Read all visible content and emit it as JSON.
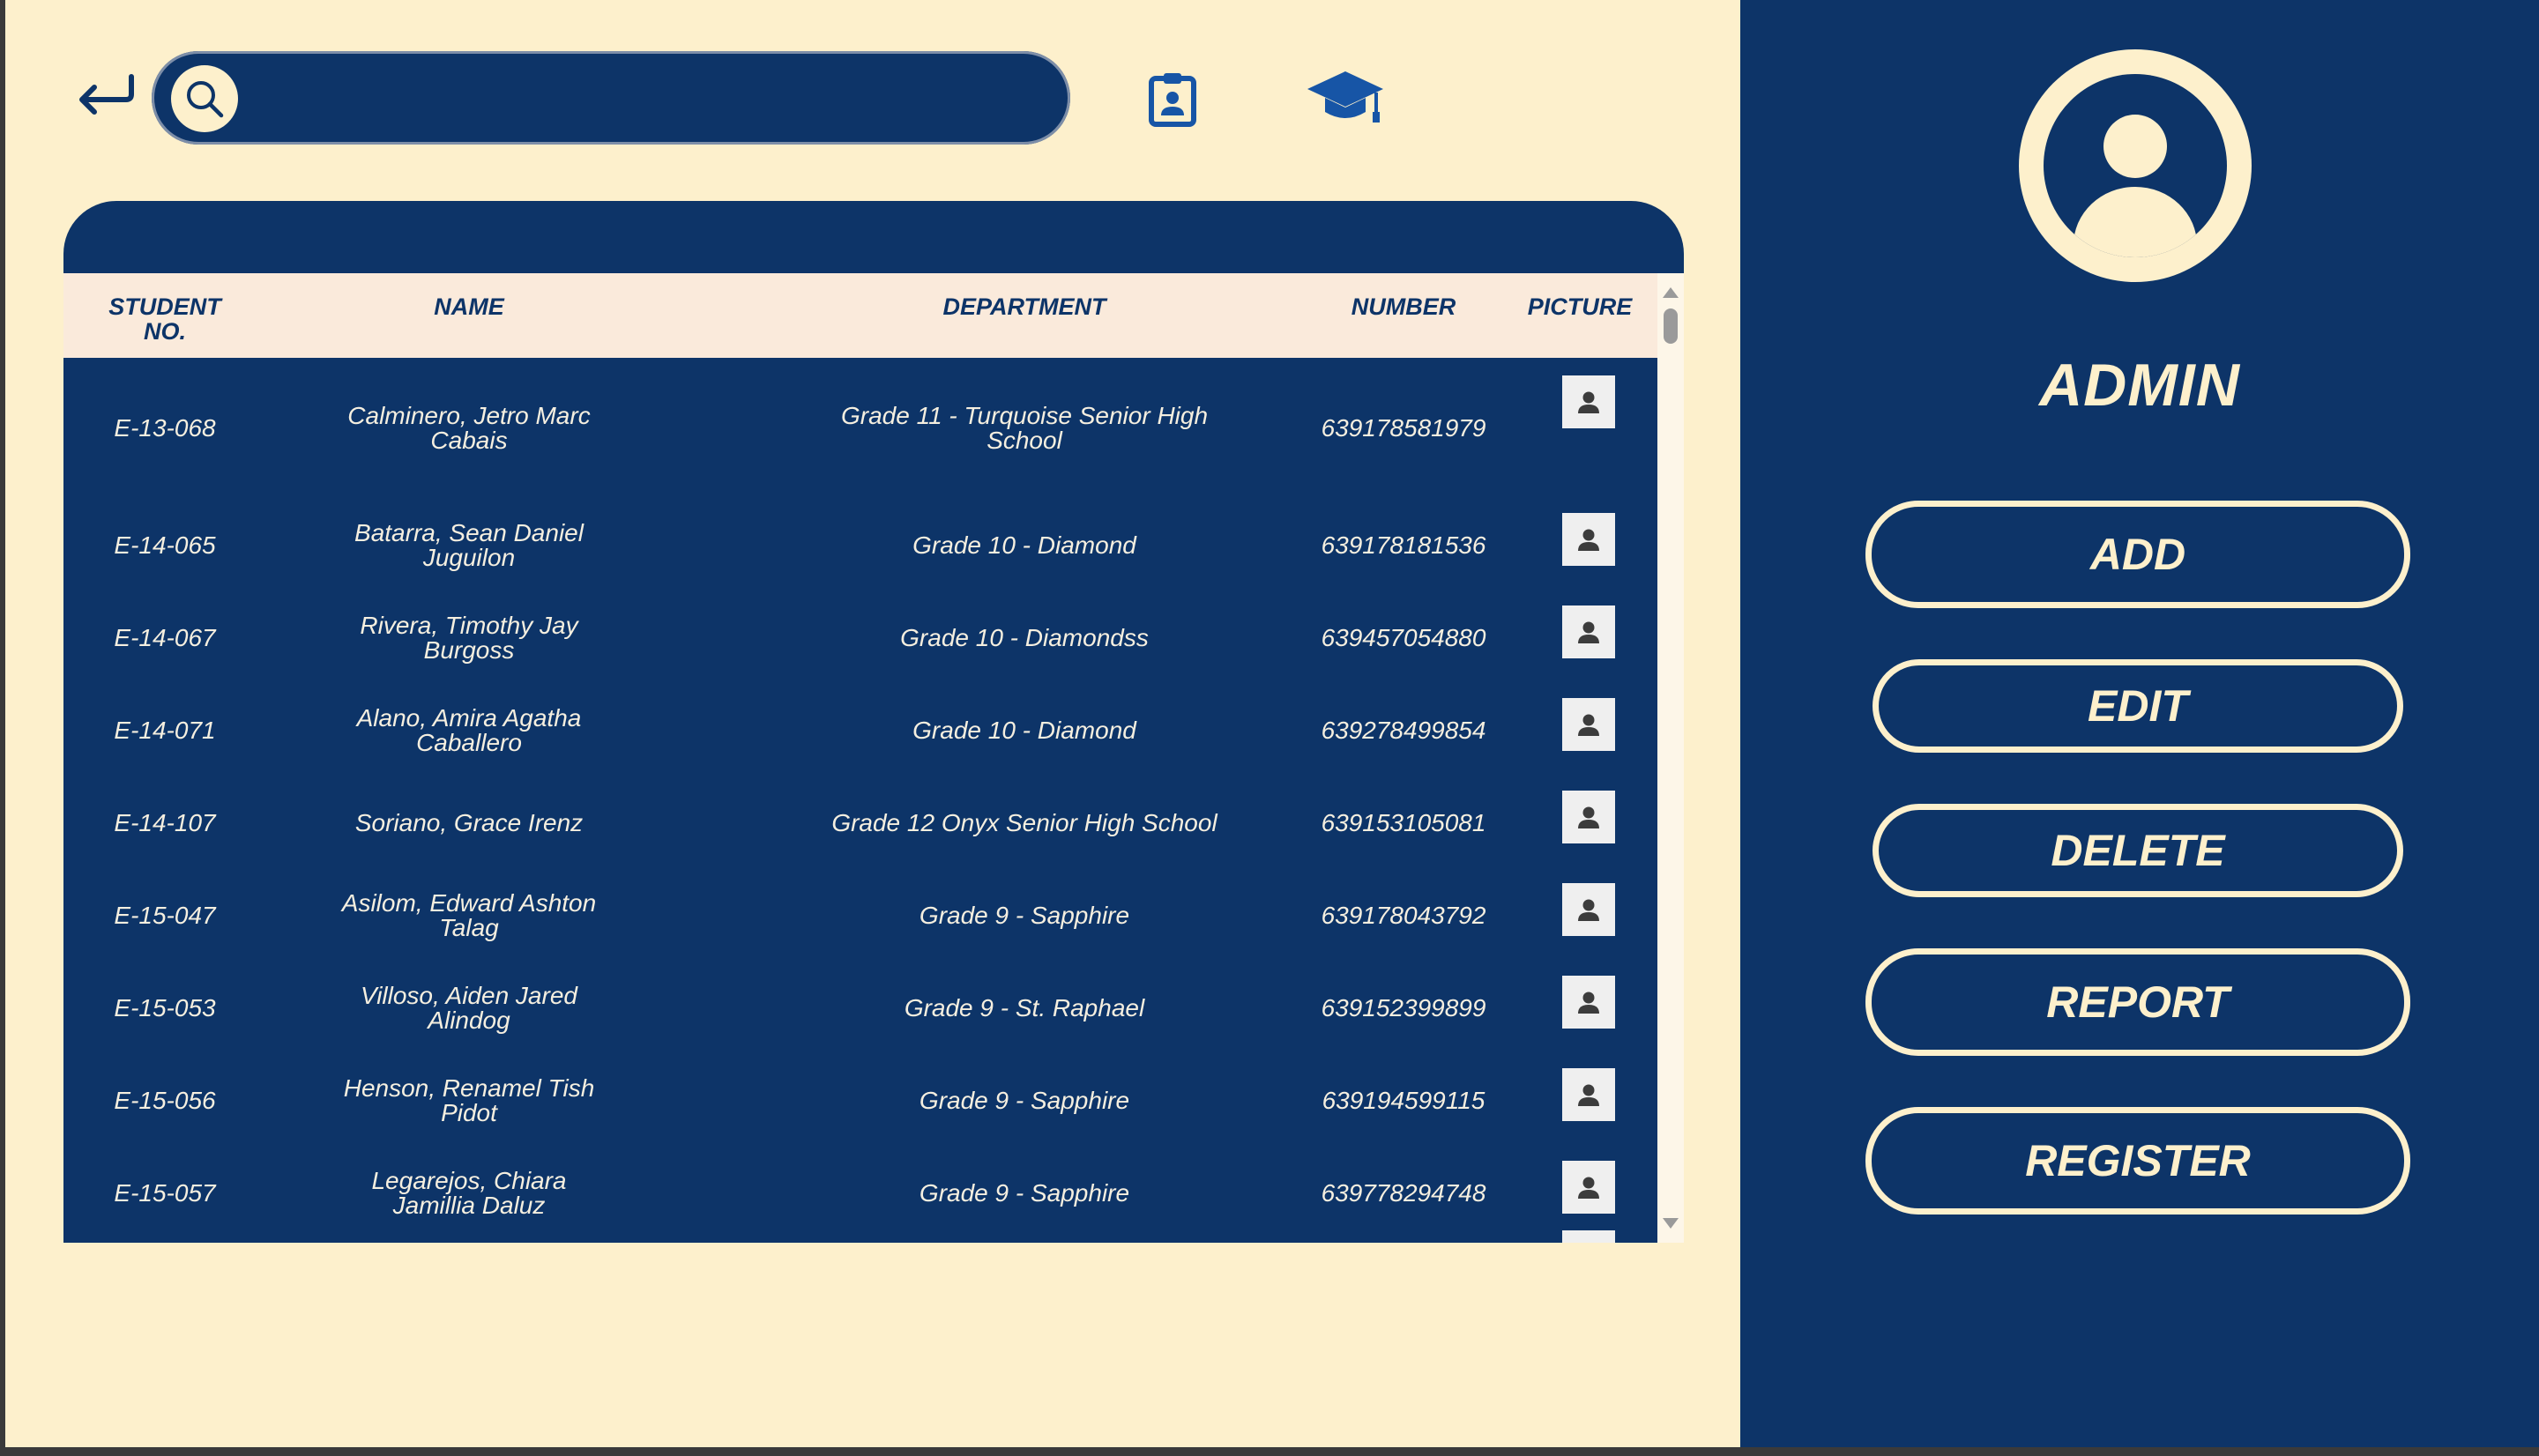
{
  "search": {
    "placeholder": "",
    "value": ""
  },
  "icons": {
    "back": "back-arrow-icon",
    "search": "search-icon",
    "student_id": "id-card-icon",
    "graduation": "graduation-cap-icon",
    "picture": "person-icon",
    "avatar": "user-avatar-icon"
  },
  "colors": {
    "primary": "#0d3468",
    "background": "#fdf0cc",
    "header_row": "#faeadb"
  },
  "table": {
    "headers": {
      "student_no": "STUDENT NO.",
      "name": "NAME",
      "department": "DEPARTMENT",
      "number": "NUMBER",
      "picture": "PICTURE"
    },
    "rows": [
      {
        "student_no": "E-13-068",
        "name": "Calminero, Jetro Marc Cabais",
        "department": "Grade 11 - Turquoise Senior High School",
        "number": "639178581979"
      },
      {
        "student_no": "E-14-065",
        "name": "Batarra, Sean Daniel Juguilon",
        "department": "Grade 10 - Diamond",
        "number": "639178181536"
      },
      {
        "student_no": "E-14-067",
        "name": "Rivera, Timothy Jay Burgoss",
        "department": "Grade 10 - Diamondss",
        "number": "639457054880"
      },
      {
        "student_no": "E-14-071",
        "name": "Alano, Amira Agatha Caballero",
        "department": "Grade 10 - Diamond",
        "number": "639278499854"
      },
      {
        "student_no": "E-14-107",
        "name": "Soriano, Grace Irenz",
        "department": "Grade 12 Onyx Senior High School",
        "number": "639153105081"
      },
      {
        "student_no": "E-15-047",
        "name": "Asilom, Edward Ashton Talag",
        "department": "Grade 9 - Sapphire",
        "number": "639178043792"
      },
      {
        "student_no": "E-15-053",
        "name": "Villoso, Aiden Jared Alindog",
        "department": "Grade 9 - St. Raphael",
        "number": "639152399899"
      },
      {
        "student_no": "E-15-056",
        "name": "Henson, Renamel Tish Pidot",
        "department": "Grade 9 - Sapphire",
        "number": "639194599115"
      },
      {
        "student_no": "E-15-057",
        "name": "Legarejos, Chiara Jamillia Daluz",
        "department": "Grade 9 - Sapphire",
        "number": "639778294748"
      }
    ]
  },
  "sidebar": {
    "role": "ADMIN",
    "buttons": {
      "add": "ADD",
      "edit": "EDIT",
      "delete": "DELETE",
      "report": "REPORT",
      "register": "REGISTER"
    }
  }
}
